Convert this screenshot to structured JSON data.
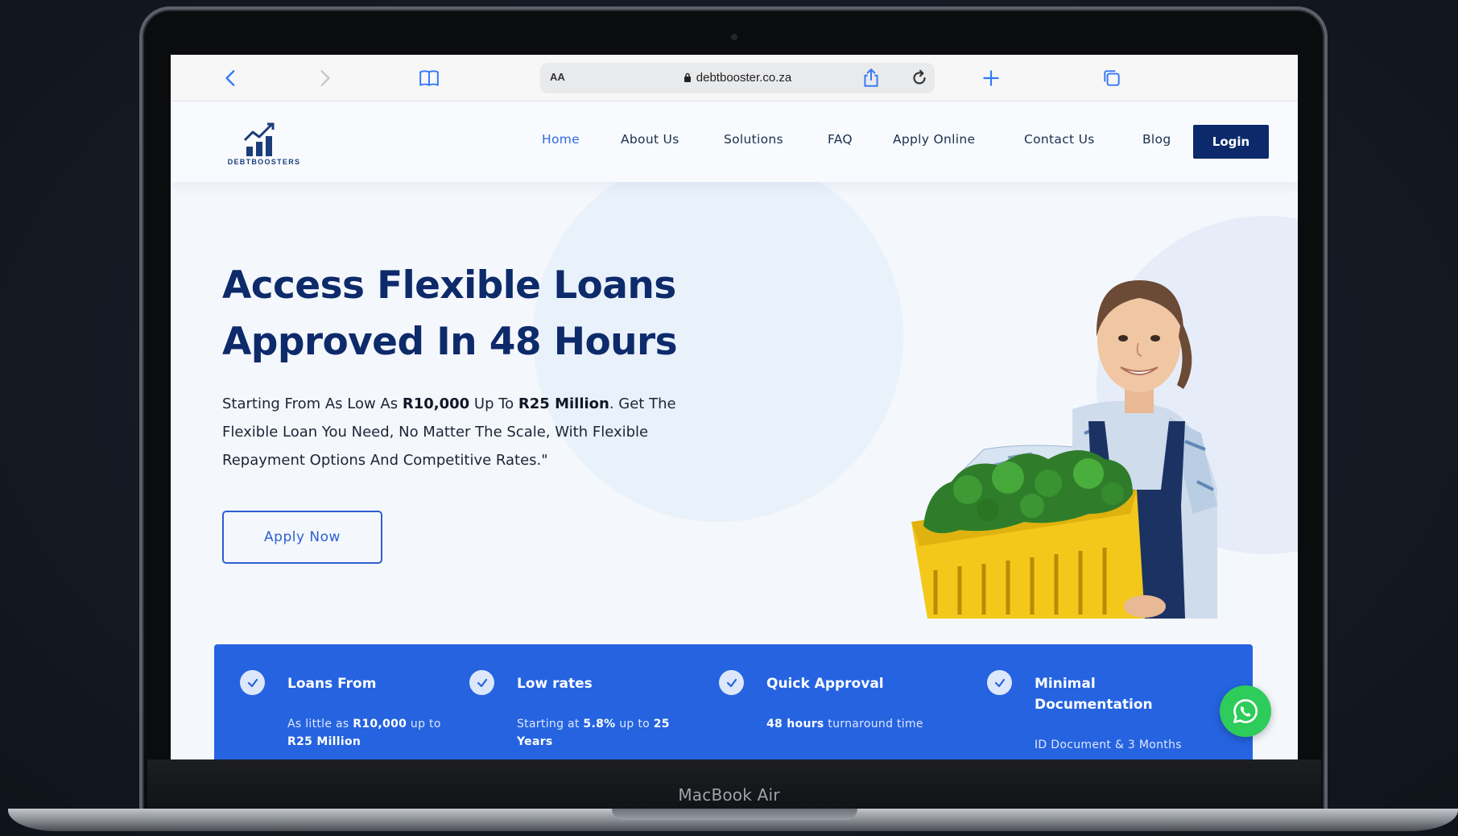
{
  "device": {
    "model_label": "MacBook Air"
  },
  "browser": {
    "aa_label": "AA",
    "url": "debtbooster.co.za",
    "icons": {
      "back": "chevron-left-icon",
      "forward": "chevron-right-icon",
      "bookmarks": "book-icon",
      "reload": "reload-icon",
      "share": "share-icon",
      "new_tab": "plus-icon",
      "tabs": "tabs-icon"
    }
  },
  "site": {
    "logo_text": "DEBTBOOSTERS",
    "nav": {
      "home": "Home",
      "about": "About Us",
      "solutions": "Solutions",
      "faq": "FAQ",
      "apply_online": "Apply Online",
      "contact": "Contact Us",
      "blog": "Blog"
    },
    "login_label": "Login",
    "hero": {
      "title_line1": "Access Flexible Loans",
      "title_line2": "Approved In 48 Hours",
      "sub_part1": "Starting From As Low As ",
      "sub_bold1": "R10,000",
      "sub_part2": " Up To ",
      "sub_bold2": "R25 Million",
      "sub_part3": ". Get The Flexible Loan You Need, No Matter The Scale, With Flexible Repayment Options And Competitive Rates.\"",
      "apply_label": "Apply Now"
    },
    "features": [
      {
        "title": "Loans From",
        "desc_pre": "As little as ",
        "desc_bold1": "R10,000",
        "desc_mid": " up to ",
        "desc_bold2": "R25 Million",
        "desc_post": ""
      },
      {
        "title": "Low rates",
        "desc_pre": "Starting at ",
        "desc_bold1": "5.8%",
        "desc_mid": " up to ",
        "desc_bold2": "25 Years",
        "desc_post": ""
      },
      {
        "title": "Quick Approval",
        "desc_pre": "",
        "desc_bold1": "48 hours",
        "desc_mid": " turnaround time",
        "desc_bold2": "",
        "desc_post": ""
      },
      {
        "title_line1": "Minimal",
        "title_line2": "Documentation",
        "desc_pre": "ID Document & 3 Months",
        "desc_bold1": "",
        "desc_mid": "",
        "desc_bold2": "",
        "desc_post": ""
      }
    ],
    "colors": {
      "brand_navy": "#0c2a6b",
      "accent_blue": "#2563e0",
      "whatsapp_green": "#2ecc5b"
    }
  }
}
